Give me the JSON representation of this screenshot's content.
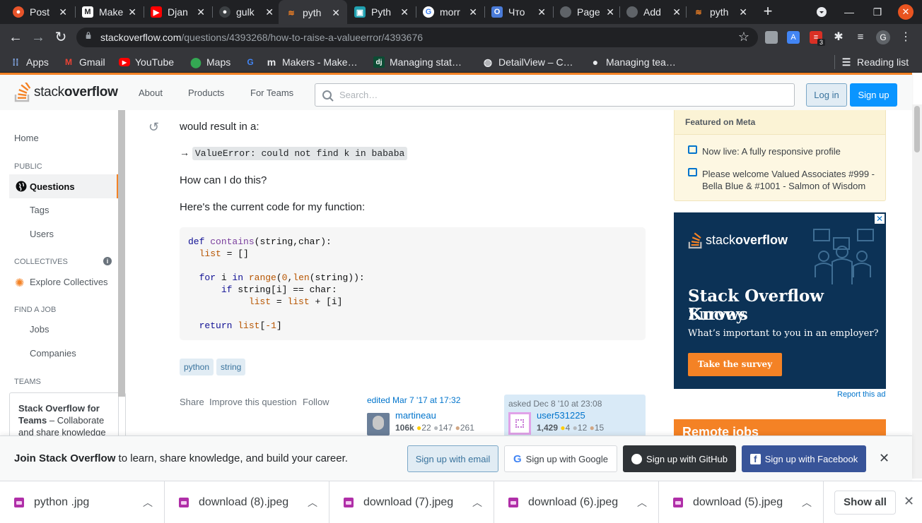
{
  "browser": {
    "tabs": [
      {
        "title": "Post",
        "favicon": "postman-icon",
        "color": "#e8542a",
        "active": false
      },
      {
        "title": "Make",
        "favicon": "makers-icon",
        "color": "#ffffff",
        "active": false
      },
      {
        "title": "Djan",
        "favicon": "youtube-icon",
        "color": "#ff0000",
        "active": false
      },
      {
        "title": "gulk",
        "favicon": "github-icon",
        "color": "#3c4043",
        "active": false
      },
      {
        "title": "pyth",
        "favicon": "stackoverflow-icon",
        "color": "#f48225",
        "active": true
      },
      {
        "title": "Pyth",
        "favicon": "profile-icon",
        "color": "#20a0b0",
        "active": false
      },
      {
        "title": "morr",
        "favicon": "google-icon",
        "color": "#4285f4",
        "active": false
      },
      {
        "title": "Что",
        "favicon": "doc-icon",
        "color": "#4a7bd8",
        "active": false
      },
      {
        "title": "Page",
        "favicon": "globe-icon",
        "color": "#5f6368",
        "active": false
      },
      {
        "title": "Add",
        "favicon": "globe-icon",
        "color": "#5f6368",
        "active": false
      },
      {
        "title": "pyth",
        "favicon": "stackoverflow-icon",
        "color": "#f48225",
        "active": false
      }
    ],
    "url_host": "stackoverflow.com",
    "url_path": "/questions/4393268/how-to-raise-a-valueerror/4393676",
    "ext_badge": "3",
    "profile_initial": "G",
    "bookmarks": [
      {
        "label": "Apps",
        "icon": "apps-grid-icon"
      },
      {
        "label": "Gmail",
        "icon": "gmail-icon"
      },
      {
        "label": "YouTube",
        "icon": "youtube-icon"
      },
      {
        "label": "Maps",
        "icon": "maps-icon"
      },
      {
        "label": "",
        "icon": "google-icon"
      },
      {
        "label": "Makers - Make…",
        "icon": "makers-icon"
      },
      {
        "label": "Managing stat…",
        "icon": "django-icon"
      },
      {
        "label": "DetailView – C…",
        "icon": "globe-icon"
      },
      {
        "label": "Managing tea…",
        "icon": "github-icon"
      }
    ],
    "reading_list": "Reading list"
  },
  "so_header": {
    "logo_text_light": "stack",
    "logo_text_bold": "overflow",
    "nav": [
      "About",
      "Products",
      "For Teams"
    ],
    "search_placeholder": "Search…",
    "login": "Log in",
    "signup": "Sign up"
  },
  "left_nav": {
    "home": "Home",
    "public_header": "PUBLIC",
    "questions": "Questions",
    "tags": "Tags",
    "users": "Users",
    "collectives_header": "COLLECTIVES",
    "explore_collectives": "Explore Collectives",
    "find_job_header": "FIND A JOB",
    "jobs": "Jobs",
    "companies": "Companies",
    "teams_header": "TEAMS",
    "teams_title": "Stack Overflow for Teams",
    "teams_desc": "– Collaborate and share knowledge"
  },
  "question": {
    "would_result": "would result in a:",
    "arrow": "→",
    "error_text": "ValueError: could not find k in bababa",
    "how_can": "How can I do this?",
    "current_code": "Here's the current code for my function:",
    "tags": [
      "python",
      "string"
    ],
    "actions": [
      "Share",
      "Improve this question",
      "Follow"
    ],
    "edited": {
      "label": "edited Mar 7 '17 at 17:32",
      "user": "martineau",
      "rep": "106k",
      "gold": "22",
      "silver": "147",
      "bronze": "261"
    },
    "asked": {
      "label": "asked Dec 8 '10 at 23:08",
      "user": "user531225",
      "rep": "1,429",
      "gold": "4",
      "silver": "12",
      "bronze": "15"
    }
  },
  "sidebar": {
    "meta_header": "Featured on Meta",
    "meta_items": [
      "Now live: A fully responsive profile",
      "Please welcome Valued Associates #999 - Bella Blue & #1001 - Salmon of Wisdom"
    ],
    "ad_logo_light": "stack",
    "ad_logo_bold": "overflow",
    "ad_title_1": "Stack Overflow Knows",
    "ad_title_2": "Survey",
    "ad_sub": "What’s important to you in an employer?",
    "ad_button": "Take the survey",
    "report_ad": "Report this ad",
    "remote_jobs": "Remote jobs"
  },
  "join_bar": {
    "bold": "Join Stack Overflow",
    "rest": " to learn, share knowledge, and build your career.",
    "email": "Sign up with email",
    "google": "Sign up with Google",
    "github": "Sign up with GitHub",
    "facebook": "Sign up with Facebook"
  },
  "downloads": {
    "items": [
      "python .jpg",
      "download (8).jpeg",
      "download (7).jpeg",
      "download (6).jpeg",
      "download (5).jpeg"
    ],
    "show_all": "Show all"
  },
  "colors": {
    "accent": "#f48225",
    "link": "#0074cc",
    "primary_button": "#0a95ff"
  }
}
